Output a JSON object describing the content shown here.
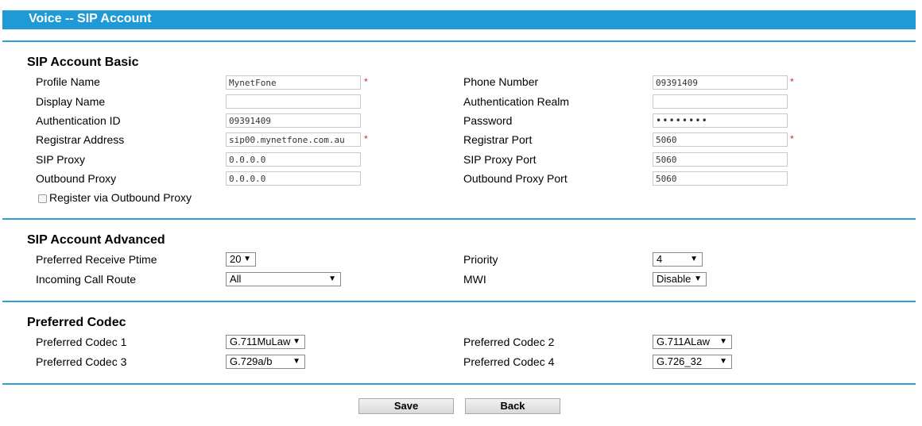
{
  "header": {
    "title": "Voice -- SIP Account"
  },
  "basic": {
    "title": "SIP Account Basic",
    "profile_name_label": "Profile Name",
    "profile_name_value": "MynetFone",
    "display_name_label": "Display Name",
    "display_name_value": "",
    "auth_id_label": "Authentication ID",
    "auth_id_value": "09391409",
    "registrar_address_label": "Registrar Address",
    "registrar_address_value": "sip00.mynetfone.com.au",
    "sip_proxy_label": "SIP Proxy",
    "sip_proxy_value": "0.0.0.0",
    "outbound_proxy_label": "Outbound Proxy",
    "outbound_proxy_value": "0.0.0.0",
    "register_via_outbound_label": "Register via Outbound Proxy",
    "phone_number_label": "Phone Number",
    "phone_number_value": "09391409",
    "auth_realm_label": "Authentication Realm",
    "auth_realm_value": "",
    "password_label": "Password",
    "password_value": "••••••••",
    "registrar_port_label": "Registrar Port",
    "registrar_port_value": "5060",
    "sip_proxy_port_label": "SIP Proxy Port",
    "sip_proxy_port_value": "5060",
    "outbound_proxy_port_label": "Outbound Proxy Port",
    "outbound_proxy_port_value": "5060",
    "required_mark": "*"
  },
  "advanced": {
    "title": "SIP Account Advanced",
    "receive_ptime_label": "Preferred Receive Ptime",
    "receive_ptime_value": "20",
    "incoming_route_label": "Incoming Call Route",
    "incoming_route_value": "All",
    "priority_label": "Priority",
    "priority_value": "4",
    "mwi_label": "MWI",
    "mwi_value": "Disable"
  },
  "codec": {
    "title": "Preferred Codec",
    "codec1_label": "Preferred Codec 1",
    "codec1_value": "G.711MuLaw",
    "codec2_label": "Preferred Codec 2",
    "codec2_value": "G.711ALaw",
    "codec3_label": "Preferred Codec 3",
    "codec3_value": "G.729a/b",
    "codec4_label": "Preferred Codec 4",
    "codec4_value": "G.726_32"
  },
  "buttons": {
    "save": "Save",
    "back": "Back"
  },
  "icons": {
    "dropdown": "▼"
  },
  "colors": {
    "header_bg": "#1f9ad6",
    "rule": "#2aa0d8",
    "required": "#e02020"
  }
}
